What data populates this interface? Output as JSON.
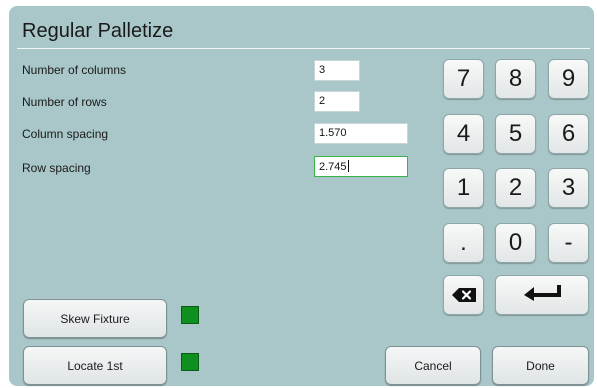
{
  "dialog": {
    "title": "Regular Palletize"
  },
  "fields": [
    {
      "label": "Number of columns",
      "value": "3"
    },
    {
      "label": "Number of rows",
      "value": "2"
    },
    {
      "label": "Column spacing",
      "value": "1.570"
    },
    {
      "label": "Row spacing",
      "value": "2.745"
    }
  ],
  "keypad": {
    "k7": "7",
    "k8": "8",
    "k9": "9",
    "k4": "4",
    "k5": "5",
    "k6": "6",
    "k1": "1",
    "k2": "2",
    "k3": "3",
    "kdot": ".",
    "k0": "0",
    "kminus": "-",
    "backspace_icon": "backspace-icon",
    "enter_icon": "enter-arrow-icon"
  },
  "buttons": {
    "skew_fixture": "Skew Fixture",
    "locate_first": "Locate 1st",
    "cancel": "Cancel",
    "done": "Done"
  },
  "colors": {
    "panel": "#a9c7c8",
    "indicator_on": "#0f8f1d",
    "active_field_border": "#3ab34a"
  }
}
